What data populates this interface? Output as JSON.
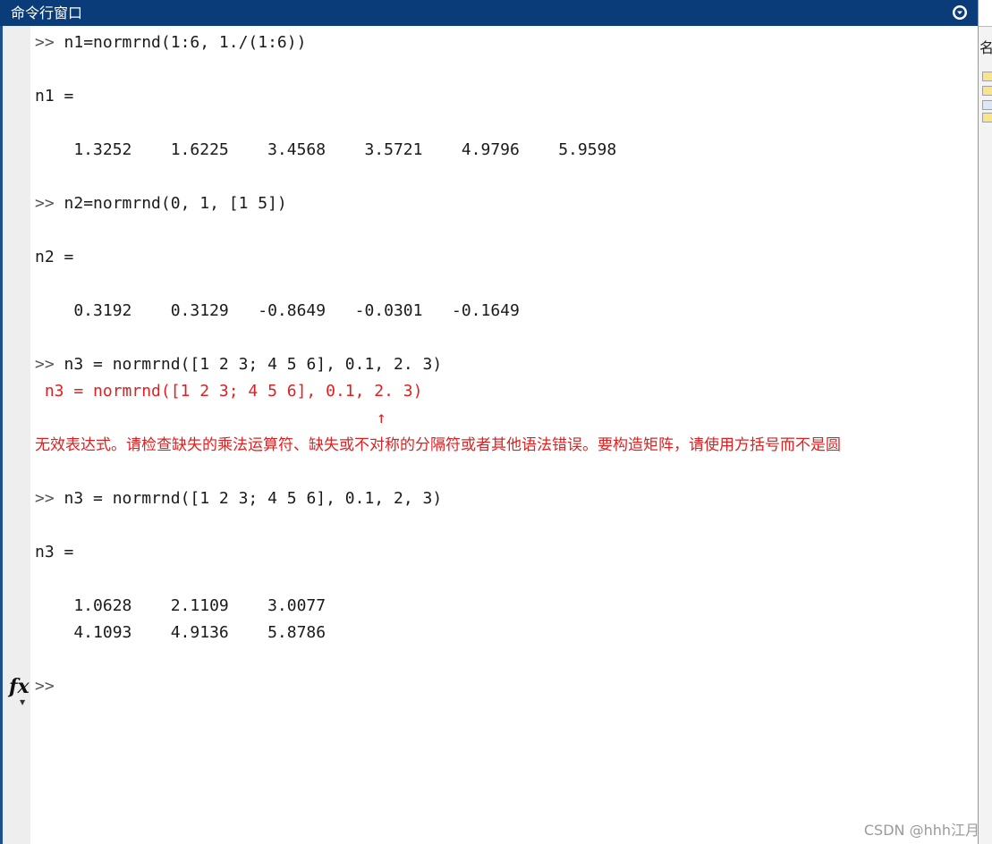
{
  "window": {
    "title": "命令行窗口"
  },
  "lines": [
    {
      "kind": "cmd",
      "prompt": ">>",
      "text": " n1=normrnd(1:6, 1./(1:6))"
    },
    {
      "kind": "out",
      "text": "n1 ="
    },
    {
      "kind": "out",
      "text": "    1.3252    1.6225    3.4568    3.5721    4.9796    5.9598"
    },
    {
      "kind": "cmd",
      "prompt": ">>",
      "text": " n2=normrnd(0, 1, [1 5])"
    },
    {
      "kind": "out",
      "text": "n2 ="
    },
    {
      "kind": "out",
      "text": "    0.3192    0.3129   -0.8649   -0.0301   -0.1649"
    },
    {
      "kind": "cmd",
      "prompt": ">>",
      "text": " n3 = normrnd([1 2 3; 4 5 6], 0.1, 2. 3)"
    },
    {
      "kind": "err",
      "text": " n3 = normrnd([1 2 3; 4 5 6], 0.1, 2. 3)"
    },
    {
      "kind": "err-caret",
      "text": "↑"
    },
    {
      "kind": "err",
      "text": "无效表达式。请检查缺失的乘法运算符、缺失或不对称的分隔符或者其他语法错误。要构造矩阵，请使用方括号而不是圆"
    },
    {
      "kind": "cmd",
      "prompt": ">>",
      "text": " n3 = normrnd([1 2 3; 4 5 6], 0.1, 2, 3)"
    },
    {
      "kind": "out",
      "text": "n3 ="
    },
    {
      "kind": "out",
      "text": "    1.0628    2.1109    3.0077"
    },
    {
      "kind": "out",
      "text": "    4.1093    4.9136    5.8786"
    },
    {
      "kind": "cmd",
      "prompt": ">>",
      "text": ""
    }
  ],
  "fx_label": "fx",
  "watermark": "CSDN @hhh江月",
  "right_panel": {
    "top_char": "名"
  }
}
